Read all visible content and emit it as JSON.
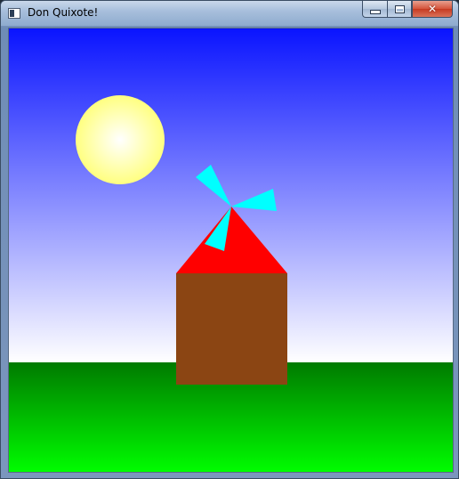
{
  "window": {
    "title": "Don Quixote!",
    "minimize_label": "",
    "maximize_label": "",
    "close_label": "✕"
  },
  "colors": {
    "sky_top": "#0a14ff",
    "sky_bottom": "#ffffff",
    "ground_top": "#007a00",
    "ground_bottom": "#00ff00",
    "sun_center": "#ffffff",
    "sun_edge": "#ffff80",
    "mill_body": "#8b4513",
    "mill_roof": "#ff0000",
    "mill_blades": "#00ffff"
  },
  "scene": {
    "icons": [
      "sun",
      "windmill",
      "windmill-roof",
      "windmill-blades"
    ]
  }
}
